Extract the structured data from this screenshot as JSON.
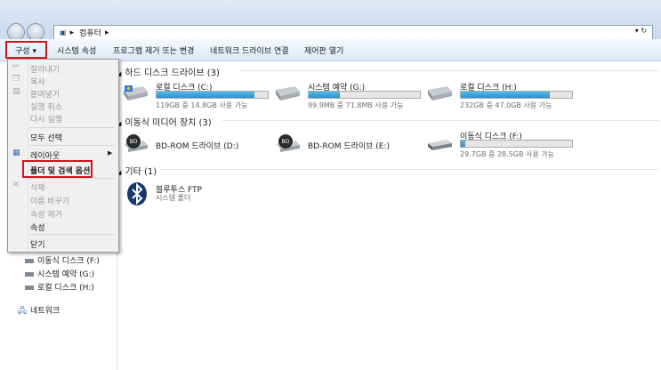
{
  "address": {
    "breadcrumb": "컴퓨터"
  },
  "toolbar": {
    "organize": "구성",
    "items": [
      "시스템 속성",
      "프로그램 제거 또는 변경",
      "네트워크 드라이브 연결",
      "제어판 열기"
    ]
  },
  "menu": {
    "items": [
      {
        "label": "잘라내기",
        "enabled": false
      },
      {
        "label": "복사",
        "enabled": false
      },
      {
        "label": "붙여넣기",
        "enabled": false
      },
      {
        "label": "실행 취소",
        "enabled": false
      },
      {
        "label": "다시 실행",
        "enabled": false
      },
      {
        "label": "모두 선택",
        "enabled": true
      },
      {
        "label": "레이아웃",
        "enabled": true
      },
      {
        "label": "폴더 및 검색 옵션",
        "enabled": true
      },
      {
        "label": "삭제",
        "enabled": false
      },
      {
        "label": "이름 바꾸기",
        "enabled": false
      },
      {
        "label": "속성 제거",
        "enabled": false
      },
      {
        "label": "속성",
        "enabled": true
      },
      {
        "label": "닫기",
        "enabled": true
      }
    ]
  },
  "nav": {
    "items": [
      "이동식 디스크 (F:)",
      "시스템 예약 (G:)",
      "로컬 디스크 (H:)"
    ],
    "network": "네트워크"
  },
  "groups": {
    "hdd": "하드 디스크 드라이브 (3)",
    "removable": "이동식 미디어 장치 (3)",
    "other": "기타 (1)"
  },
  "drives": [
    {
      "name": "로컬 디스크 (C:)",
      "info": "119GB 중 14.8GB 사용 가능",
      "used_fraction": 0.88
    },
    {
      "name": "시스템 예약 (G:)",
      "info": "99.9MB 중 71.8MB 사용 가능",
      "used_fraction": 0.28
    },
    {
      "name": "로컬 디스크 (H:)",
      "info": "232GB 중 47.0GB 사용 가능",
      "used_fraction": 0.8
    },
    {
      "name": "BD-ROM 드라이브 (D:)"
    },
    {
      "name": "BD-ROM 드라이브 (E:)"
    },
    {
      "name": "이동식 디스크 (F:)",
      "info": "29.7GB 중 28.5GB 사용 가능",
      "used_fraction": 0.04
    }
  ],
  "other": {
    "name": "블루투스 FTP",
    "sub": "시스템 폴더"
  },
  "colors": {
    "highlight": "#d7121c",
    "bar_fill": "#2b93c9"
  }
}
